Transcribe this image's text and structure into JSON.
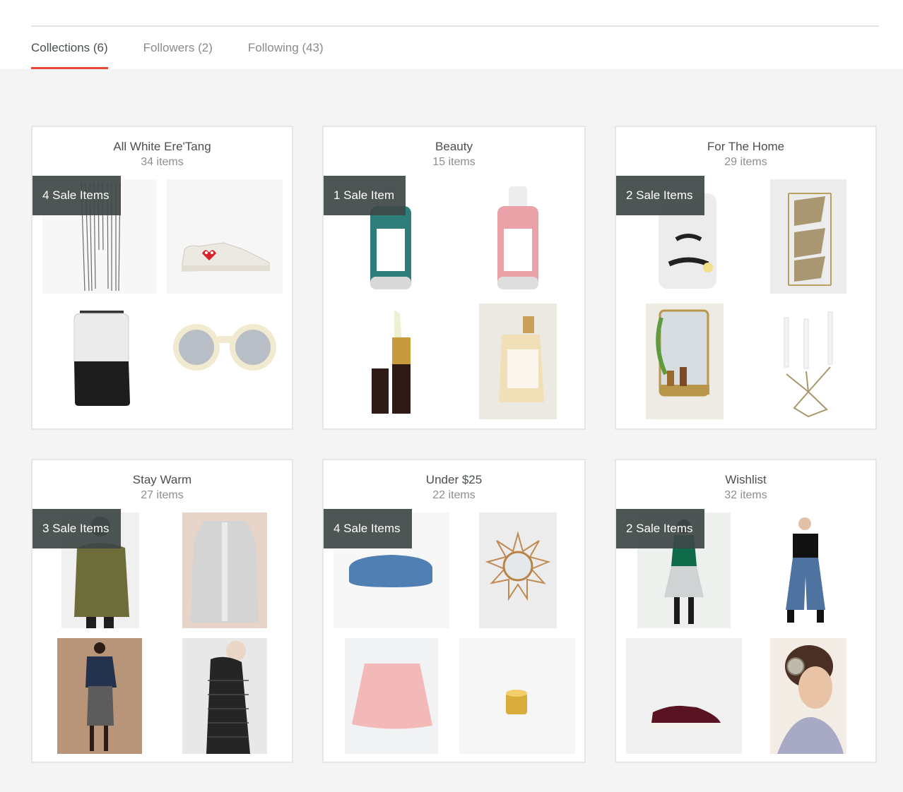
{
  "tabs": [
    {
      "label": "Collections (6)",
      "active": true
    },
    {
      "label": "Followers (2)",
      "active": false
    },
    {
      "label": "Following (43)",
      "active": false
    }
  ],
  "colors": {
    "accent": "#e8453c",
    "badge": "#3f4646",
    "background": "#f4f4f4"
  },
  "collections": [
    {
      "title": "All White Ere'Tang",
      "count": "34 items",
      "sale_badge": "4 Sale Items",
      "items": [
        "striped-pants-image",
        "white-sneaker-image",
        "backpack-image",
        "sunglasses-image"
      ]
    },
    {
      "title": "Beauty",
      "count": "15 items",
      "sale_badge": "1 Sale Item",
      "items": [
        "teal-shampoo-image",
        "pink-conditioner-image",
        "lipstick-image",
        "rahua-conditioner-image"
      ]
    },
    {
      "title": "For The Home",
      "count": "29 items",
      "sale_badge": "2 Sale Items",
      "items": [
        "face-vase-image",
        "gold-rack-image",
        "gold-mirror-shelf-image",
        "candelabra-image"
      ]
    },
    {
      "title": "Stay Warm",
      "count": "27 items",
      "sale_badge": "3 Sale Items",
      "items": [
        "olive-parka-image",
        "grey-cardigan-image",
        "navy-sweater-skirt-image",
        "black-puffer-image"
      ]
    },
    {
      "title": "Under $25",
      "count": "22 items",
      "sale_badge": "4 Sale Items",
      "items": [
        "denim-glasses-case-image",
        "rattan-sun-mirror-image",
        "pink-skirt-image",
        "gold-ring-image"
      ]
    },
    {
      "title": "Wishlist",
      "count": "32 items",
      "sale_badge": "2 Sale Items",
      "items": [
        "metallic-skirt-outfit-image",
        "culottes-outfit-image",
        "velvet-sneaker-image",
        "headphones-image"
      ]
    }
  ]
}
